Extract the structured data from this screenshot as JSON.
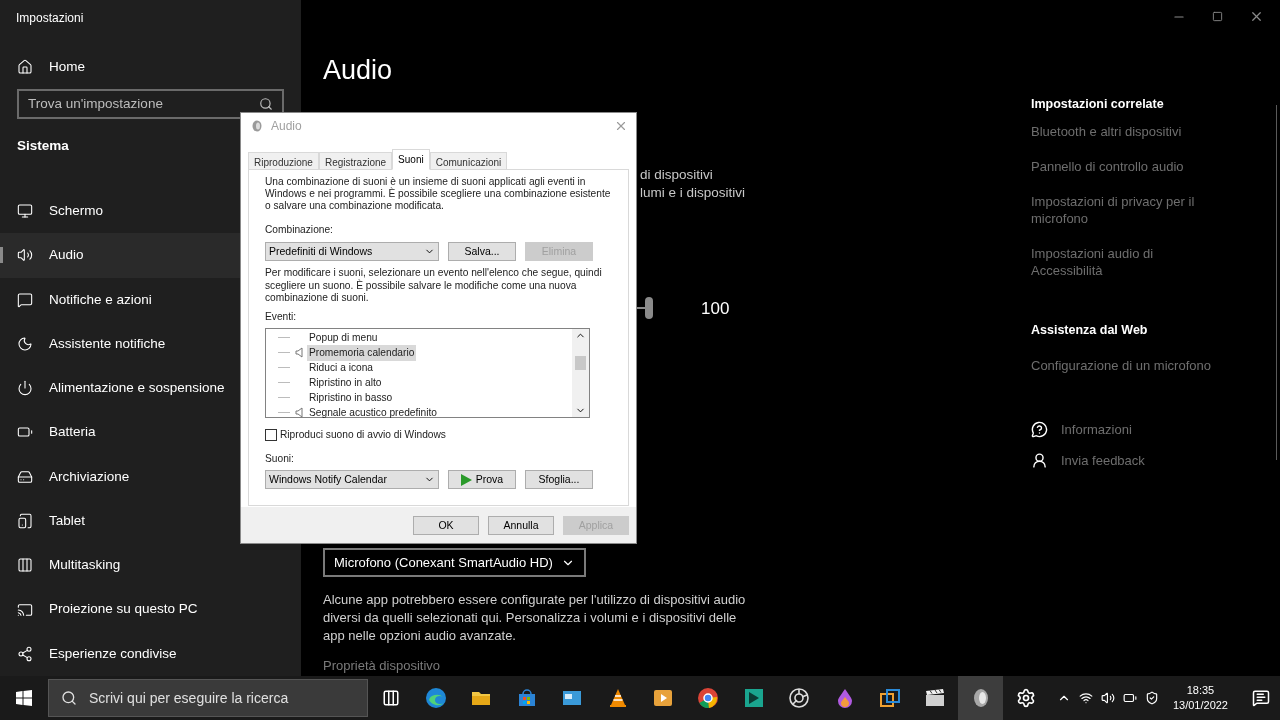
{
  "window": {
    "title": "Impostazioni"
  },
  "sidebar": {
    "home": "Home",
    "search": {
      "placeholder": "Trova un'impostazione"
    },
    "section": "Sistema",
    "items": [
      {
        "label": "Schermo",
        "selected": false
      },
      {
        "label": "Audio",
        "selected": true
      },
      {
        "label": "Notifiche e azioni",
        "selected": false
      },
      {
        "label": "Assistente notifiche",
        "selected": false
      },
      {
        "label": "Alimentazione e sospensione",
        "selected": false
      },
      {
        "label": "Batteria",
        "selected": false
      },
      {
        "label": "Archiviazione",
        "selected": false
      },
      {
        "label": "Tablet",
        "selected": false
      },
      {
        "label": "Multitasking",
        "selected": false
      },
      {
        "label": "Proiezione su questo PC",
        "selected": false
      },
      {
        "label": "Esperienze condivise",
        "selected": false
      }
    ]
  },
  "main": {
    "title": "Audio",
    "fragments": [
      "di dispositivi",
      "lumi e i dispositivi"
    ],
    "volume": {
      "level": 1,
      "reading": "100"
    },
    "input_device": "Microfono (Conexant SmartAudio HD)",
    "note": "Alcune app potrebbero essere configurate per l'utilizzo di dispositivi audio diversi da quelli selezionati qui. Personalizza i volumi e i dispositivi delle app nelle opzioni audio avanzate.",
    "link": "Proprietà dispositivo"
  },
  "related": {
    "title": "Impostazioni correlate",
    "links": [
      "Bluetooth e altri dispositivi",
      "Pannello di controllo audio",
      "Impostazioni di privacy per il microfono",
      "Impostazioni audio di Accessibilità"
    ]
  },
  "web_help": {
    "title": "Assistenza dal Web",
    "links": [
      "Configurazione di un microfono"
    ]
  },
  "footer_links": [
    "Informazioni",
    "Invia feedback"
  ],
  "dialog": {
    "title": "Audio",
    "tabs": [
      {
        "label": "Riproduzione",
        "selected": false
      },
      {
        "label": "Registrazione",
        "selected": false
      },
      {
        "label": "Suoni",
        "selected": true
      },
      {
        "label": "Comunicazioni",
        "selected": false
      }
    ],
    "intro": "Una combinazione di suoni è un insieme di suoni applicati agli eventi in Windows e nei programmi. È possibile scegliere una combinazione esistente o salvare una combinazione modificata.",
    "scheme_label": "Combinazione:",
    "scheme": "Predefiniti di Windows",
    "scheme_buttons": [
      {
        "label": "Salva...",
        "disabled": false
      },
      {
        "label": "Elimina",
        "disabled": true
      }
    ],
    "instructions": "Per modificare i suoni, selezionare un evento nell'elenco che segue, quindi scegliere un suono. È possibile salvare le modifiche come una nuova combinazione di suoni.",
    "events_label": "Eventi:",
    "events": [
      {
        "label": "Popup di menu",
        "has_sound": false,
        "selected": false
      },
      {
        "label": "Promemoria calendario",
        "has_sound": true,
        "selected": true
      },
      {
        "label": "Riduci a icona",
        "has_sound": false,
        "selected": false
      },
      {
        "label": "Ripristino in alto",
        "has_sound": false,
        "selected": false
      },
      {
        "label": "Ripristino in basso",
        "has_sound": false,
        "selected": false
      },
      {
        "label": "Segnale acustico predefinito",
        "has_sound": true,
        "selected": false
      }
    ],
    "startup_sound": {
      "label": "Riproduci suono di avvio di Windows",
      "checked": false
    },
    "sounds_label": "Suoni:",
    "sound": "Windows Notify Calendar",
    "test_button": "Prova",
    "browse_button": "Sfoglia...",
    "footer_buttons": [
      {
        "label": "OK",
        "disabled": false
      },
      {
        "label": "Annulla",
        "disabled": false
      },
      {
        "label": "Applica",
        "disabled": true
      }
    ]
  },
  "taskbar": {
    "search": {
      "placeholder": "Scrivi qui per eseguire la ricerca"
    },
    "apps": [
      {
        "kind": "taskview",
        "active": false
      },
      {
        "kind": "browser",
        "active": false
      },
      {
        "kind": "folder",
        "active": false
      },
      {
        "kind": "store",
        "active": false
      },
      {
        "kind": "window",
        "active": false
      },
      {
        "kind": "cone",
        "active": false
      },
      {
        "kind": "player",
        "active": false
      },
      {
        "kind": "chrome",
        "active": false
      },
      {
        "kind": "editor",
        "active": false
      },
      {
        "kind": "aperture",
        "active": false
      },
      {
        "kind": "drop",
        "active": false
      },
      {
        "kind": "layers",
        "active": false
      },
      {
        "kind": "clapper",
        "active": false
      },
      {
        "kind": "speaker",
        "active": true
      },
      {
        "kind": "gear",
        "active": false
      }
    ],
    "time": "18:35",
    "date": "13/01/2022"
  }
}
